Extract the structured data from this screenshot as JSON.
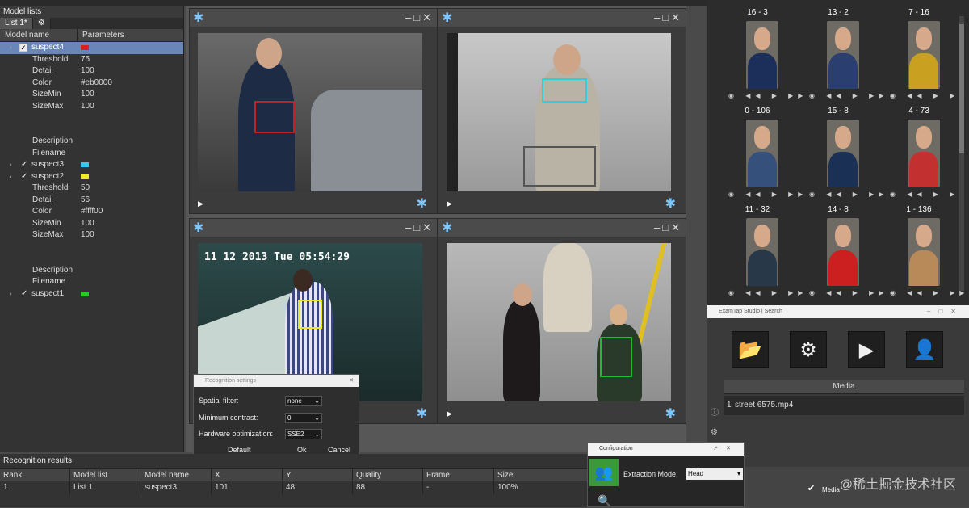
{
  "left_panel": {
    "title": "Model lists",
    "tab": "List 1*",
    "columns": [
      "Model name",
      "Parameters"
    ],
    "rows": [
      {
        "type": "model",
        "name": "suspect4",
        "color": "#e02020",
        "checked": "box",
        "selected": true
      },
      {
        "type": "param",
        "key": "Threshold",
        "value": "75"
      },
      {
        "type": "param",
        "key": "Detail",
        "value": "100"
      },
      {
        "type": "param",
        "key": "Color",
        "value": "#eb0000"
      },
      {
        "type": "param",
        "key": "SizeMin",
        "value": "100"
      },
      {
        "type": "param",
        "key": "SizeMax",
        "value": "100"
      },
      {
        "type": "param",
        "key": "",
        "value": "",
        "dim": true
      },
      {
        "type": "param",
        "key": "",
        "value": "",
        "dim": true
      },
      {
        "type": "param",
        "key": "Description",
        "value": ""
      },
      {
        "type": "param",
        "key": "Filename",
        "value": ""
      },
      {
        "type": "model",
        "name": "suspect3",
        "color": "#33ccee",
        "checked": "tick"
      },
      {
        "type": "model",
        "name": "suspect2",
        "color": "#eeee22",
        "checked": "tick"
      },
      {
        "type": "param",
        "key": "Threshold",
        "value": "50"
      },
      {
        "type": "param",
        "key": "Detail",
        "value": "56"
      },
      {
        "type": "param",
        "key": "Color",
        "value": "#ffff00"
      },
      {
        "type": "param",
        "key": "SizeMin",
        "value": "100"
      },
      {
        "type": "param",
        "key": "SizeMax",
        "value": "100"
      },
      {
        "type": "param",
        "key": "",
        "value": "",
        "dim": true
      },
      {
        "type": "param",
        "key": "",
        "value": "",
        "dim": true
      },
      {
        "type": "param",
        "key": "Description",
        "value": ""
      },
      {
        "type": "param",
        "key": "Filename",
        "value": ""
      },
      {
        "type": "model",
        "name": "suspect1",
        "color": "#22cc22",
        "checked": "tick"
      }
    ]
  },
  "video_panels": [
    {
      "id": "tl",
      "box_color": "#c0202a"
    },
    {
      "id": "tr",
      "box_color": "#33ccdd"
    },
    {
      "id": "bl",
      "box_color": "#e8e822",
      "overlay_text": "11 12 2013 Tue 05:54:29"
    },
    {
      "id": "br",
      "box_color": "#22bb33"
    }
  ],
  "faces": [
    {
      "label": "16 - 3",
      "body": "#1c2f5a"
    },
    {
      "label": "13 - 2",
      "body": "#2a3f70"
    },
    {
      "label": "7 - 16",
      "body": "#c9a020"
    },
    {
      "label": "0 - 106",
      "body": "#35507a"
    },
    {
      "label": "15 - 8",
      "body": "#1a3055"
    },
    {
      "label": "4 - 73",
      "body": "#c23030"
    },
    {
      "label": "11 - 32",
      "body": "#283848"
    },
    {
      "label": "14 - 8",
      "body": "#cc2020"
    },
    {
      "label": "1 - 136",
      "body": "#b88a5a"
    }
  ],
  "search_window": {
    "title": "ExamTap Studio | Search",
    "media_header": "Media",
    "media_rows": [
      {
        "num": "1",
        "name": "street 6575.mp4"
      }
    ]
  },
  "recognition_dialog": {
    "title": "Recognition settings",
    "fields": [
      {
        "label": "Spatial filter:",
        "value": "none"
      },
      {
        "label": "Minimum contrast:",
        "value": "0"
      },
      {
        "label": "Hardware optimization:",
        "value": "SSE2"
      }
    ],
    "buttons": {
      "default": "Default",
      "ok": "Ok",
      "cancel": "Cancel"
    }
  },
  "results": {
    "title": "Recognition results",
    "columns": [
      "Rank",
      "Model list",
      "Model name",
      "X",
      "Y",
      "Quality",
      "Frame",
      "Size"
    ],
    "rows": [
      [
        "1",
        "List 1",
        "suspect3",
        "101",
        "48",
        "88",
        "-",
        "100%"
      ]
    ]
  },
  "config": {
    "title": "Configuration",
    "label": "Extraction Mode",
    "value": "Head"
  },
  "bottom_right": {
    "media_label": "Media",
    "watermark": "@稀土掘金技术社区"
  }
}
